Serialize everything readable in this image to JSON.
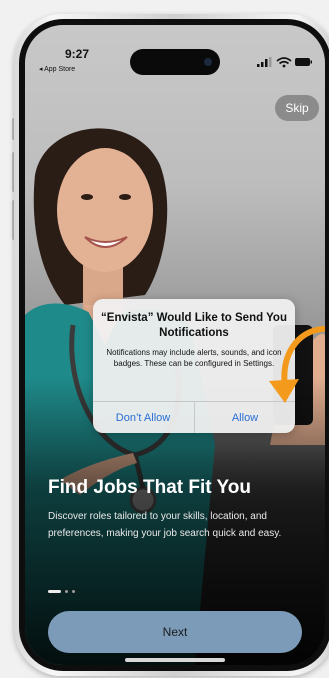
{
  "status_bar": {
    "time": "9:27",
    "back_label": "◂ App Store"
  },
  "onboarding": {
    "skip_label": "Skip",
    "headline": "Find Jobs That Fit You",
    "description": "Discover roles tailored to your skills, location, and preferences, making your job search quick and easy.",
    "page_index": 1,
    "page_count": 3,
    "next_label": "Next"
  },
  "permission_alert": {
    "title": "“Envista” Would Like to Send You Notifications",
    "message": "Notifications may include alerts, sounds, and icon badges. These can be configured in Settings.",
    "deny_label": "Don’t Allow",
    "allow_label": "Allow"
  },
  "icons": {
    "signal": "signal-icon",
    "wifi": "wifi-icon",
    "battery": "battery-icon",
    "arrow": "curved-arrow-icon"
  },
  "colors": {
    "next_button": "#7c9bb8",
    "alert_button_text": "#2a6fd6",
    "arrow": "#f39a1c",
    "scrubs": "#1f8a8a"
  }
}
